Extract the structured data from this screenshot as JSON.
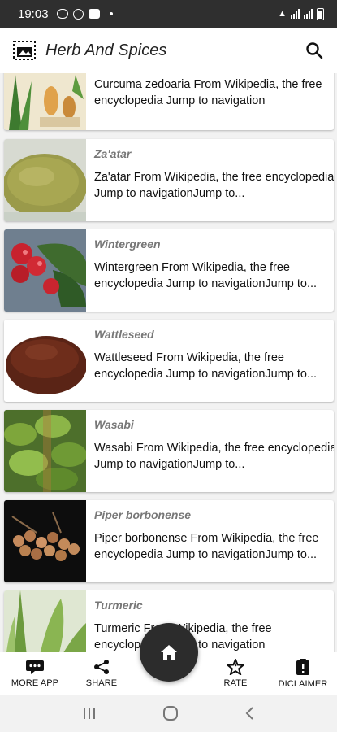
{
  "status_bar": {
    "time": "19:03"
  },
  "app_bar": {
    "title": "Herb And Spices"
  },
  "items": [
    {
      "title": "",
      "description": "Curcuma zedoaria From Wikipedia, the free encyclopedia Jump to navigation",
      "image": "curcuma-illustration"
    },
    {
      "title": "Za'atar",
      "description": "Za'atar From Wikipedia, the free encyclopedia Jump to navigationJump to...",
      "image": "zaatar-powder"
    },
    {
      "title": "Wintergreen",
      "description": "Wintergreen From Wikipedia, the free encyclopedia Jump to navigationJump to...",
      "image": "wintergreen-berries"
    },
    {
      "title": "Wattleseed",
      "description": "Wattleseed From Wikipedia, the free encyclopedia Jump to navigationJump to...",
      "image": "wattleseed-powder"
    },
    {
      "title": "Wasabi",
      "description": "Wasabi From Wikipedia, the free encyclopedia Jump to navigationJump to...",
      "image": "wasabi-plant"
    },
    {
      "title": "Piper borbonense",
      "description": "Piper borbonense From Wikipedia, the free encyclopedia Jump to navigationJump to...",
      "image": "piper-peppercorns"
    },
    {
      "title": "Turmeric",
      "description": "Turmeric From Wikipedia, the free encyclopedia Jump to navigation",
      "image": "turmeric-plant"
    }
  ],
  "bottom_nav": {
    "more_app": "MORE APP",
    "share": "SHARE",
    "rate": "RATE",
    "disclaimer": "DICLAIMER"
  },
  "colors": {
    "status_bar": "#2f2f2f",
    "fab": "#2c2c2c",
    "title_gray": "#777777"
  }
}
